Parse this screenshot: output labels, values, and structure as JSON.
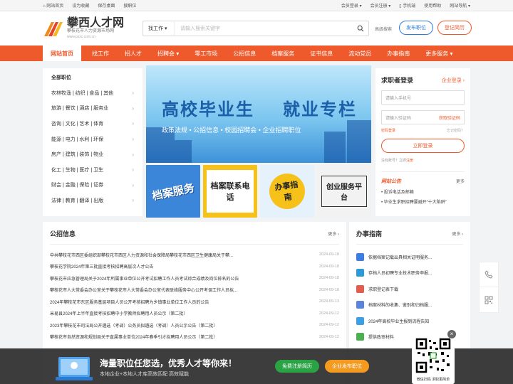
{
  "topbar": {
    "home": "网站首页",
    "favorite": "设为收藏",
    "save_desktop": "保存桌面",
    "recruit": "搜职位",
    "member_login": "会员登录",
    "member_register": "会员注册",
    "mobile": "手机端",
    "help": "使用帮助",
    "site_nav": "网站导航"
  },
  "logo": {
    "title": "攀西人才网",
    "subtitle": "攀枝花市人力资源市场网",
    "url": "www.pzxc.com.cn"
  },
  "search": {
    "type": "找工作",
    "placeholder": "请输入搜索关键字",
    "advanced": "高级搜索"
  },
  "header_buttons": {
    "post_job": "发布职位",
    "register_resume": "登记简历"
  },
  "nav": [
    "网站首页",
    "找工作",
    "招人才",
    "招聘会",
    "零工市场",
    "公招信息",
    "档案服务",
    "证书信息",
    "流动党员",
    "办事指南",
    "更多服务"
  ],
  "categories": {
    "header": "全部职位",
    "items": [
      "农林牧渔 | 纺织 | 食品 | 其他",
      "旅游 | 餐饮 | 酒店 | 服务业",
      "咨询 | 文化 | 艺术 | 体育",
      "能源 | 电力 | 水利 | 环保",
      "房产 | 建筑 | 装饰 | 物业",
      "化工 | 生物 | 医疗 | 卫生",
      "财会 | 金融 | 保险 | 证券",
      "法律 | 教育 | 翻译 | 出版"
    ]
  },
  "banner": {
    "title_left": "高校毕业生",
    "title_right": "就业专栏",
    "subtitle": "政策法规 • 公招信息 • 校园招聘会 • 企业招聘职位"
  },
  "tiles": [
    "档案服务",
    "档案联系电话",
    "办事指南",
    "创业服务平台"
  ],
  "login": {
    "title": "求职者登录",
    "enterprise": "企业登录",
    "phone_placeholder": "请输入手机号",
    "code_placeholder": "请输入验证码",
    "get_code": "获取验证码",
    "password_login": "密码登录",
    "forgot": "忘记密码？",
    "submit": "立即登录",
    "no_account": "没有账号？立即",
    "register": "注册",
    "notice_title": "网站公告",
    "notice_more": "更多",
    "notices": [
      "• 投诉电话及邮箱",
      "• 毕业生求职招聘要避开“十大陷阱”"
    ]
  },
  "news": {
    "title": "公招信息",
    "more": "更多",
    "items": [
      {
        "title": "中共攀枝花市西区委组织部攀枝花市西区人力资源和社会保障局攀枝花市西区卫生健康局关于攀...",
        "date": "2024-09-18"
      },
      {
        "title": "攀枝花学院2024年第三批直接考核招聘高层次人才公告",
        "date": "2024-09-18"
      },
      {
        "title": "攀枝花市应急管理局关于2024年所属事业单位公开考试招聘工作人员考试综合成绩及岗位排名的公告",
        "date": "2024-09-18"
      },
      {
        "title": "攀枝花市人大常委会办公室关于攀枝花市人大常委会办公室代表联络服务中心公开考调工作人员拟...",
        "date": "2024-09-18"
      },
      {
        "title": "2024年攀枝花市东区服务基层项目人员公开考核招聘为乡镇事业单位工作人员的公告",
        "date": "2024-09-13"
      },
      {
        "title": "米易县2024年上半年直接考核招聘中小学教师拟聘用人员公示（第二批）",
        "date": "2024-09-12"
      },
      {
        "title": "2023年攀枝花市司法局公开遴选（考调）公务员拟遴选（考调）人员公示公告（第二批）",
        "date": "2024-09-12"
      },
      {
        "title": "攀枝花市自然资源和规划局关于直属事业单位2024年春季引才拟聘用人员公示（第二批）",
        "date": "2024-09-12"
      }
    ]
  },
  "guide": {
    "title": "办事指南",
    "more": "更多",
    "items": [
      "依据档案记载出具相关证明服务...",
      "存档人员初聘专业技术职务申报...",
      "求职登记表下载",
      "档案材料的收集、鉴别和归档服...",
      "2024年高校毕业生报到流程告知",
      "提供政审材料"
    ],
    "icon_colors": [
      "#3b7de0",
      "#2b9bd8",
      "#e25d4e",
      "#5a83d9",
      "#3aa0e3",
      "#4caf50"
    ]
  },
  "promo": {
    "headline": "海量职位任您选，优秀人才等你来！",
    "sub": "本地企业+本地人才库高效匹配 高效赋能",
    "btn_register": "免费注册简历",
    "btn_post": "企业发布职位",
    "qr_caption": "微信扫码 求职更简单"
  },
  "colors": {
    "brand": "#ee5a2c",
    "blue": "#2b7ce0",
    "green": "#2aa345",
    "orange": "#f39a1f"
  }
}
